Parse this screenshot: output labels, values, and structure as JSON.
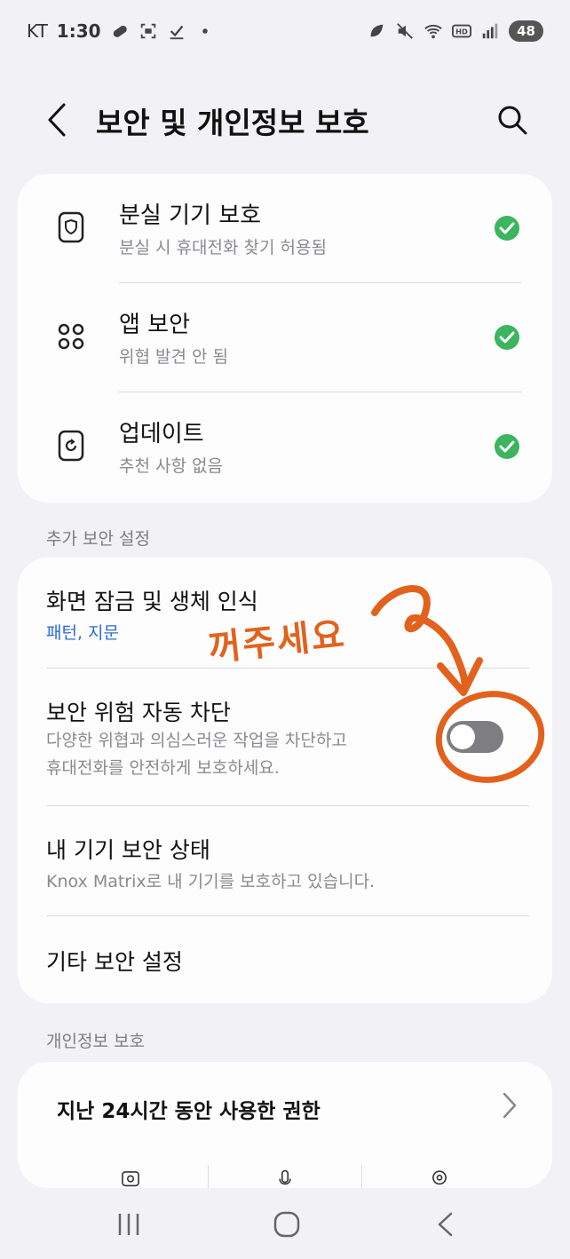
{
  "status_bar": {
    "carrier": "KT",
    "time": "1:30",
    "battery": "48"
  },
  "header": {
    "title": "보안 및 개인정보 보호"
  },
  "protection_items": [
    {
      "title": "분실 기기 보호",
      "subtitle": "분실 시 휴대전화 찾기 허용됨",
      "icon": "lost-device-shield-icon"
    },
    {
      "title": "앱 보안",
      "subtitle": "위협 발견 안 됨",
      "icon": "apps-grid-icon"
    },
    {
      "title": "업데이트",
      "subtitle": "추천 사항 없음",
      "icon": "update-refresh-icon"
    }
  ],
  "status_color": "#3bb55e",
  "additional_security": {
    "label": "추가 보안 설정",
    "items": [
      {
        "title": "화면 잠금 및 생체 인식",
        "subtitle": "패턴, 지문"
      },
      {
        "title": "보안 위험 자동 차단",
        "subtitle_line1": "다양한 위협과 의심스러운 작업을 차단하고",
        "subtitle_line2": "휴대전화를 안전하게 보호하세요.",
        "toggle_on": false
      },
      {
        "title": "내 기기 보안 상태",
        "subtitle": "Knox Matrix로 내 기기를 보호하고 있습니다."
      },
      {
        "title": "기타 보안 설정"
      }
    ]
  },
  "privacy": {
    "label": "개인정보 보호",
    "permissions_title": "지난 24시간 동안 사용한 권한",
    "permission_icons": [
      "camera-icon",
      "microphone-icon",
      "location-icon"
    ]
  },
  "annotation": {
    "text": "꺼주세요",
    "color": "#e2621d"
  },
  "nav": {
    "icons": [
      "recent-apps-icon",
      "home-icon",
      "back-nav-icon"
    ]
  }
}
